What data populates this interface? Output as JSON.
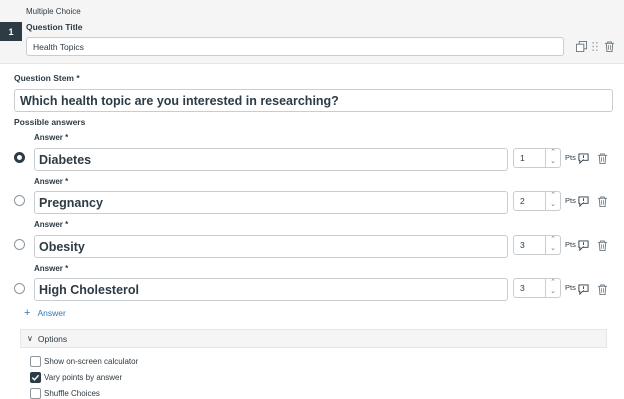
{
  "question": {
    "number": "1",
    "type": "Multiple Choice",
    "title_label": "Question Title",
    "title_value": "Health Topics",
    "stem_label": "Question Stem *",
    "stem_value": "Which health topic are you interested in researching?",
    "possible_answers_label": "Possible answers"
  },
  "header_icons": [
    "duplicate-icon",
    "drag-handle-icon",
    "trash-icon"
  ],
  "answers": [
    {
      "label": "Answer *",
      "text": "Diabetes",
      "points": "1",
      "pts_label": "Pts",
      "selected": true
    },
    {
      "label": "Answer *",
      "text": "Pregnancy",
      "points": "2",
      "pts_label": "Pts",
      "selected": false
    },
    {
      "label": "Answer *",
      "text": "Obesity",
      "points": "3",
      "pts_label": "Pts",
      "selected": false
    },
    {
      "label": "Answer *",
      "text": "High Cholesterol",
      "points": "3",
      "pts_label": "Pts",
      "selected": false
    }
  ],
  "add_answer_label": "Answer",
  "options": {
    "toggle_label": "Options",
    "items": [
      {
        "label": "Show on-screen calculator",
        "checked": false
      },
      {
        "label": "Vary points by answer",
        "checked": true
      },
      {
        "label": "Shuffle Choices",
        "checked": false
      }
    ]
  },
  "colors": {
    "accent_link": "#2b7abc",
    "number_badge": "#2d3b45",
    "header_band": "#f5f5f5"
  }
}
